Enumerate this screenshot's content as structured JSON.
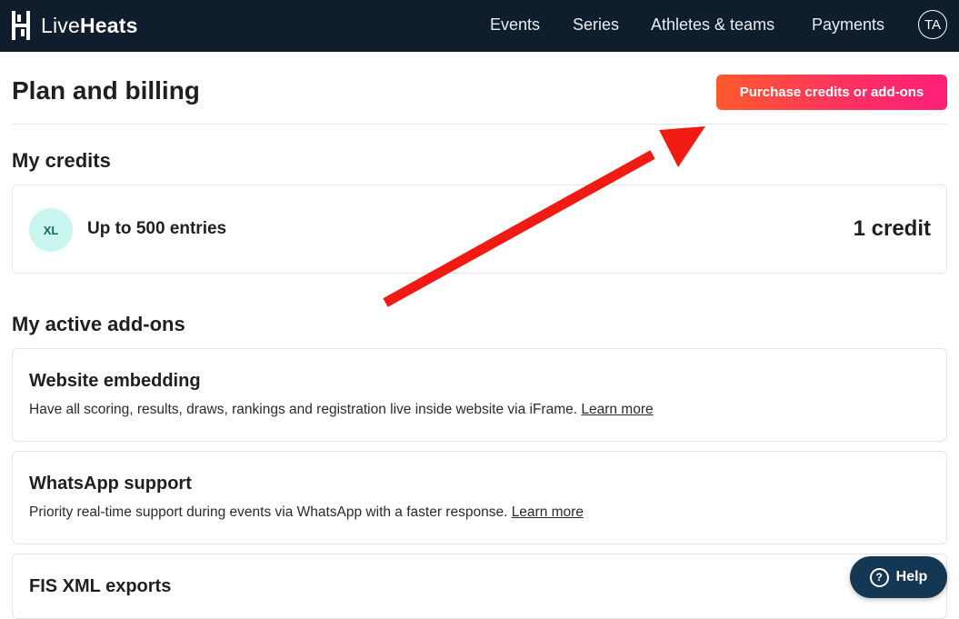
{
  "app": {
    "logo_light": "Live",
    "logo_bold": "Heats"
  },
  "nav": {
    "items": [
      "Events",
      "Series",
      "Athletes & teams",
      "Payments"
    ],
    "user_initials": "TA"
  },
  "header": {
    "title": "Plan and billing",
    "purchase_button": "Purchase credits or add-ons"
  },
  "credits": {
    "section_title": "My credits",
    "badge": "XL",
    "name": "Up to 500 entries",
    "count": "1 credit"
  },
  "addons": {
    "section_title": "My active add-ons",
    "items": [
      {
        "title": "Website embedding",
        "description": "Have all scoring, results, draws, rankings and registration live inside website via iFrame.",
        "link": "Learn more"
      },
      {
        "title": "WhatsApp support",
        "description": "Priority real-time support during events via WhatsApp with a faster response.",
        "link": "Learn more"
      },
      {
        "title": "FIS XML exports"
      }
    ]
  },
  "help": {
    "label": "Help",
    "icon": "question-mark"
  },
  "colors": {
    "topbar": "#0f1d2c",
    "accent_start": "#ff5a2d",
    "accent_end": "#ff1f78",
    "annotation_arrow": "#f21b14",
    "help_button": "#143753"
  }
}
